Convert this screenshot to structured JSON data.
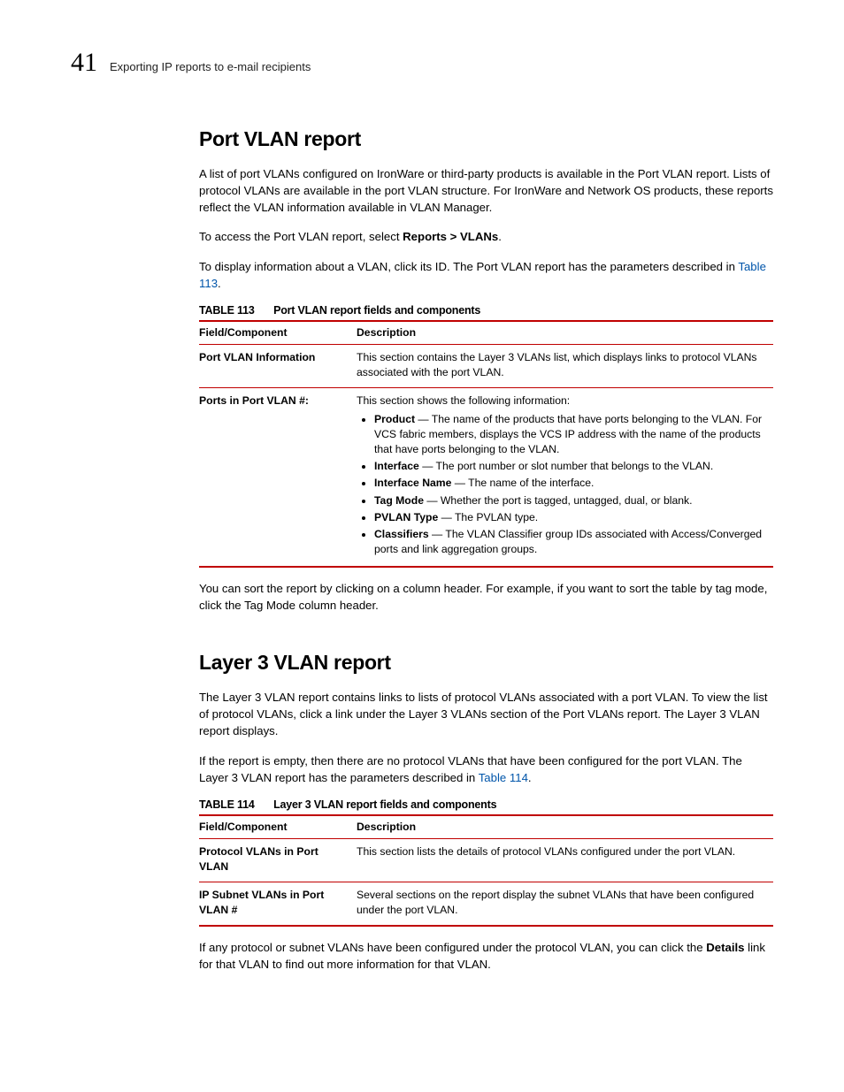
{
  "header": {
    "chapter_number": "41",
    "running_title": "Exporting IP reports to e-mail recipients"
  },
  "section1": {
    "heading": "Port VLAN report",
    "para1": "A list of port VLANs configured on IronWare or third-party products is available in the Port VLAN report. Lists of protocol VLANs are available in the port VLAN structure. For IronWare and Network OS products, these reports reflect the VLAN information available in VLAN Manager.",
    "para2_pre": "To access the Port VLAN report, select ",
    "para2_bold": "Reports > VLANs",
    "para2_post": ".",
    "para3_pre": "To display information about a VLAN, click its ID. The Port VLAN report has the parameters described in ",
    "para3_link": "Table 113",
    "para3_post": "."
  },
  "table113": {
    "label": "TABLE 113",
    "title": "Port VLAN report fields and components",
    "col1": "Field/Component",
    "col2": "Description",
    "row1": {
      "field": "Port VLAN Information",
      "desc": "This section contains the Layer 3 VLANs list, which displays links to protocol VLANs associated with the port VLAN."
    },
    "row2": {
      "field": "Ports in Port VLAN #:",
      "intro": "This section shows the following information:",
      "items": {
        "product_term": "Product",
        "product_desc": " — The name of the products that have ports belonging to the VLAN. For VCS fabric members, displays the VCS IP address with the name of the products that have ports belonging to the VLAN.",
        "interface_term": "Interface",
        "interface_desc": " — The port number or slot number that belongs to the VLAN.",
        "iname_term": "Interface Name",
        "iname_desc": " — The name of the interface.",
        "tag_term": "Tag Mode",
        "tag_desc": " — Whether the port is tagged, untagged, dual, or blank.",
        "pvlan_term": "PVLAN Type",
        "pvlan_desc": " — The PVLAN type.",
        "class_term": "Classifiers",
        "class_desc": " — The VLAN Classifier group IDs associated with Access/Converged ports and link aggregation groups."
      }
    }
  },
  "after_t113": "You can sort the report by clicking on a column header. For example, if you want to sort the table by tag mode, click the Tag Mode column header.",
  "section2": {
    "heading": "Layer 3 VLAN report",
    "para1": "The Layer 3 VLAN report contains links to lists of protocol VLANs associated with a port VLAN. To view the list of protocol VLANs, click a link under the Layer 3 VLANs section of the Port VLANs report. The Layer 3 VLAN report displays.",
    "para2_pre": "If the report is empty, then there are no protocol VLANs that have been configured for the port VLAN. The Layer 3 VLAN report has the parameters described in ",
    "para2_link": "Table 114",
    "para2_post": "."
  },
  "table114": {
    "label": "TABLE 114",
    "title": "Layer 3 VLAN report fields and components",
    "col1": "Field/Component",
    "col2": "Description",
    "row1": {
      "field": "Protocol VLANs in Port VLAN",
      "desc": "This section lists the details of protocol VLANs configured under the port VLAN."
    },
    "row2": {
      "field": "IP Subnet VLANs in Port VLAN #",
      "desc": "Several sections on the report display the subnet VLANs that have been configured under the port VLAN."
    }
  },
  "after_t114": {
    "pre": "If any protocol or subnet VLANs have been configured under the protocol VLAN, you can click the ",
    "bold": "Details",
    "post": " link for that VLAN to find out more information for that VLAN."
  }
}
